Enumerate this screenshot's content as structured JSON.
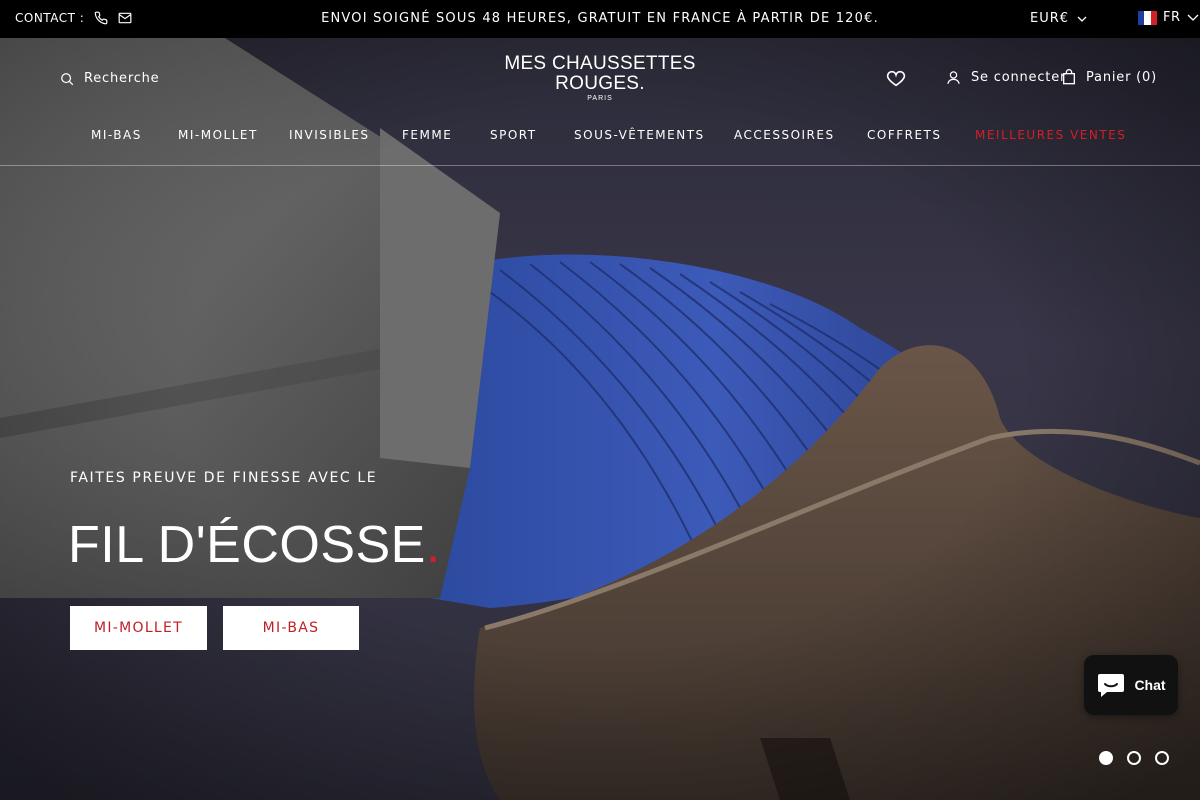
{
  "topbar": {
    "contact_label": "CONTACT :",
    "announcement": "ENVOI SOIGNÉ SOUS 48 HEURES, GRATUIT EN FRANCE À PARTIR DE 120€.",
    "currency": "EUR€",
    "language": "FR"
  },
  "header": {
    "search_label": "Recherche",
    "logo_line1": "MES CHAUSSETTES",
    "logo_line2": "ROUGES.",
    "logo_line3": "PARIS",
    "login_label": "Se connecter",
    "cart_label": "Panier (0)"
  },
  "nav": {
    "items": [
      "MI-BAS",
      "MI-MOLLET",
      "INVISIBLES",
      "FEMME",
      "SPORT",
      "SOUS-VÊTEMENTS",
      "ACCESSOIRES",
      "COFFRETS",
      "MEILLEURES VENTES"
    ]
  },
  "hero": {
    "kicker": "FAITES PREUVE DE FINESSE AVEC LE",
    "headline": "FIL D'ÉCOSSE",
    "headline_dot": ".",
    "button1": "MI-MOLLET",
    "button2": "MI-BAS"
  },
  "chat": {
    "label": "Chat"
  },
  "slider": {
    "current": 1,
    "total": 3
  },
  "colors": {
    "accent_red": "#d21f28",
    "topbar_bg": "#000000",
    "chat_bg": "#111111"
  }
}
